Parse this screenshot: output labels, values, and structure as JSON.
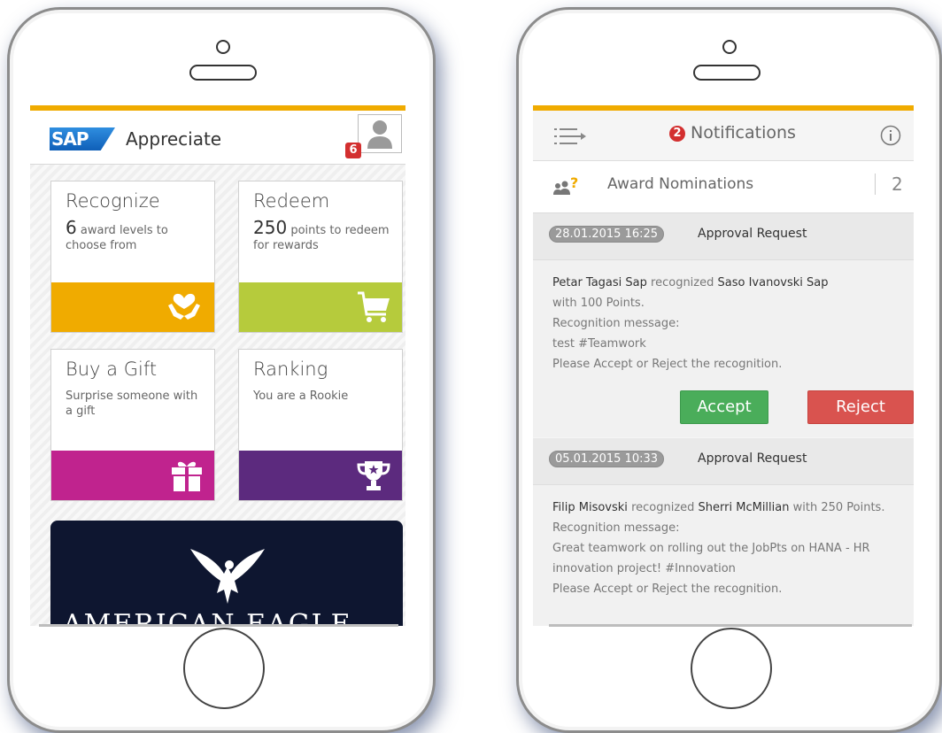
{
  "left_app": {
    "logo_text": "SAP",
    "title": "Appreciate",
    "notification_count": "6",
    "tiles": [
      {
        "title": "Recognize",
        "number": "6",
        "desc": "award levels to choose from",
        "color": "#f0ab00",
        "icon": "heart-hands-icon"
      },
      {
        "title": "Redeem",
        "number": "250",
        "desc": "points to redeem for rewards",
        "color": "#b6cb3c",
        "icon": "cart-icon"
      },
      {
        "title": "Buy a Gift",
        "number": "",
        "desc": "Surprise someone with a gift",
        "color": "#c0238e",
        "icon": "gift-icon"
      },
      {
        "title": "Ranking",
        "number": "",
        "desc": "You are a Rookie",
        "color": "#5c2a7e",
        "icon": "trophy-icon"
      }
    ],
    "banner_text": "AMERICAN EAGLE"
  },
  "right_app": {
    "header_badge": "2",
    "header_title": "Notifications",
    "award_label": "Award Nominations",
    "award_count": "2",
    "notifications": [
      {
        "date": "28.01.2015 16:25",
        "type": "Approval Request",
        "giver": "Petar Tagasi Sap",
        "verb": "recognized",
        "receiver": "Saso Ivanovski Sap",
        "points": "with 100 Points.",
        "msg_label": "Recognition message:",
        "message": "test #Teamwork",
        "prompt": "Please Accept or Reject the recognition.",
        "accept_label": "Accept",
        "reject_label": "Reject"
      },
      {
        "date": "05.01.2015 10:33",
        "type": "Approval Request",
        "giver": "Filip Misovski",
        "verb": "recognized",
        "receiver": "Sherri McMillian",
        "points": "with 250 Points.",
        "msg_label": "Recognition message:",
        "message": "Great teamwork on rolling out the JobPts on HANA - HR innovation project! #Innovation",
        "prompt": "Please Accept or Reject the recognition."
      }
    ]
  },
  "colors": {
    "accent_bar": "#f0ab00",
    "accept": "#4aad5a",
    "reject": "#d9534f",
    "badge": "#d32f2f"
  }
}
